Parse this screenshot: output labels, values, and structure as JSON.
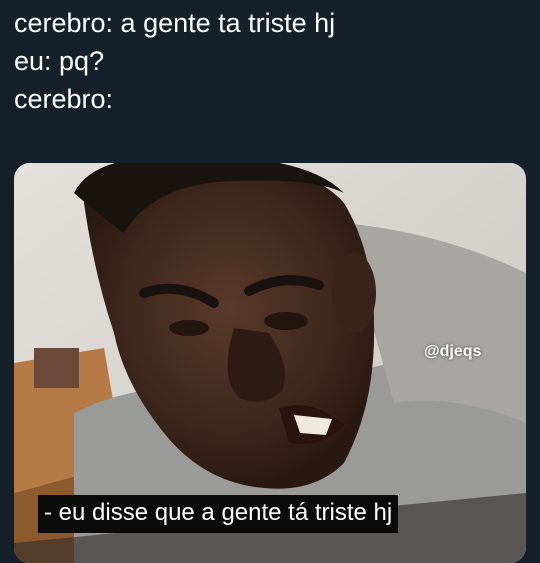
{
  "tweet": {
    "lines": [
      "cerebro: a gente ta triste hj",
      "eu: pq?",
      "cerebro:"
    ]
  },
  "media": {
    "watermark": "@djeqs",
    "caption": "- eu disse que a gente tá triste hj"
  },
  "colors": {
    "background": "#15202b",
    "text": "#ffffff",
    "caption_bg": "#0b0b0b"
  }
}
